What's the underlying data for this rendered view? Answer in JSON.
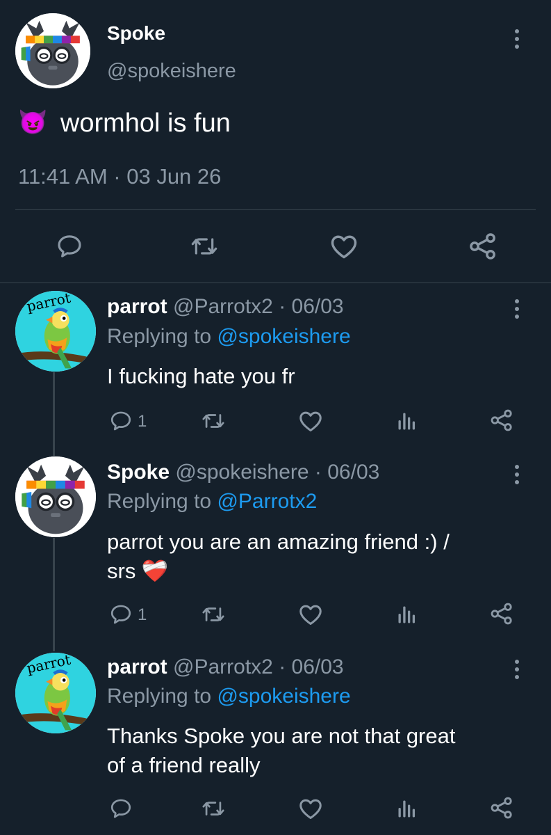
{
  "main_tweet": {
    "author_name": "Spoke",
    "author_handle": "@spokeishere",
    "emoji": "😈",
    "text": "wormhol is fun",
    "timestamp": "11:41 AM · 03 Jun 26"
  },
  "replies": [
    {
      "author_name": "parrot",
      "meta": "@Parrotx2 · 06/03",
      "replying_prefix": "Replying to",
      "replying_to": "@spokeishere",
      "text_lines": [
        "I fucking hate you fr"
      ],
      "reply_count": "1"
    },
    {
      "author_name": "Spoke",
      "meta": "@spokeishere · 06/03",
      "replying_prefix": "Replying to",
      "replying_to": "@Parrotx2",
      "text_lines": [
        "parrot you are an amazing friend :) /",
        "srs ❤️‍🩹"
      ],
      "reply_count": "1"
    },
    {
      "author_name": "parrot",
      "meta": "@Parrotx2 · 06/03",
      "replying_prefix": "Replying to",
      "replying_to": "@spokeishere",
      "text_lines": [
        "Thanks Spoke you are not that great",
        "of a friend really"
      ],
      "reply_count": ""
    }
  ],
  "parrot_avatar_text": "parrot",
  "icons": {
    "reply": "reply-icon",
    "retweet": "retweet-icon",
    "like": "heart-icon",
    "share": "share-icon",
    "analytics": "analytics-icon",
    "more": "more-vertical-icon"
  },
  "colors": {
    "background": "#15202b",
    "text": "#ffffff",
    "muted": "#8b98a5",
    "link": "#1d9bf0",
    "divider": "#38444d"
  }
}
